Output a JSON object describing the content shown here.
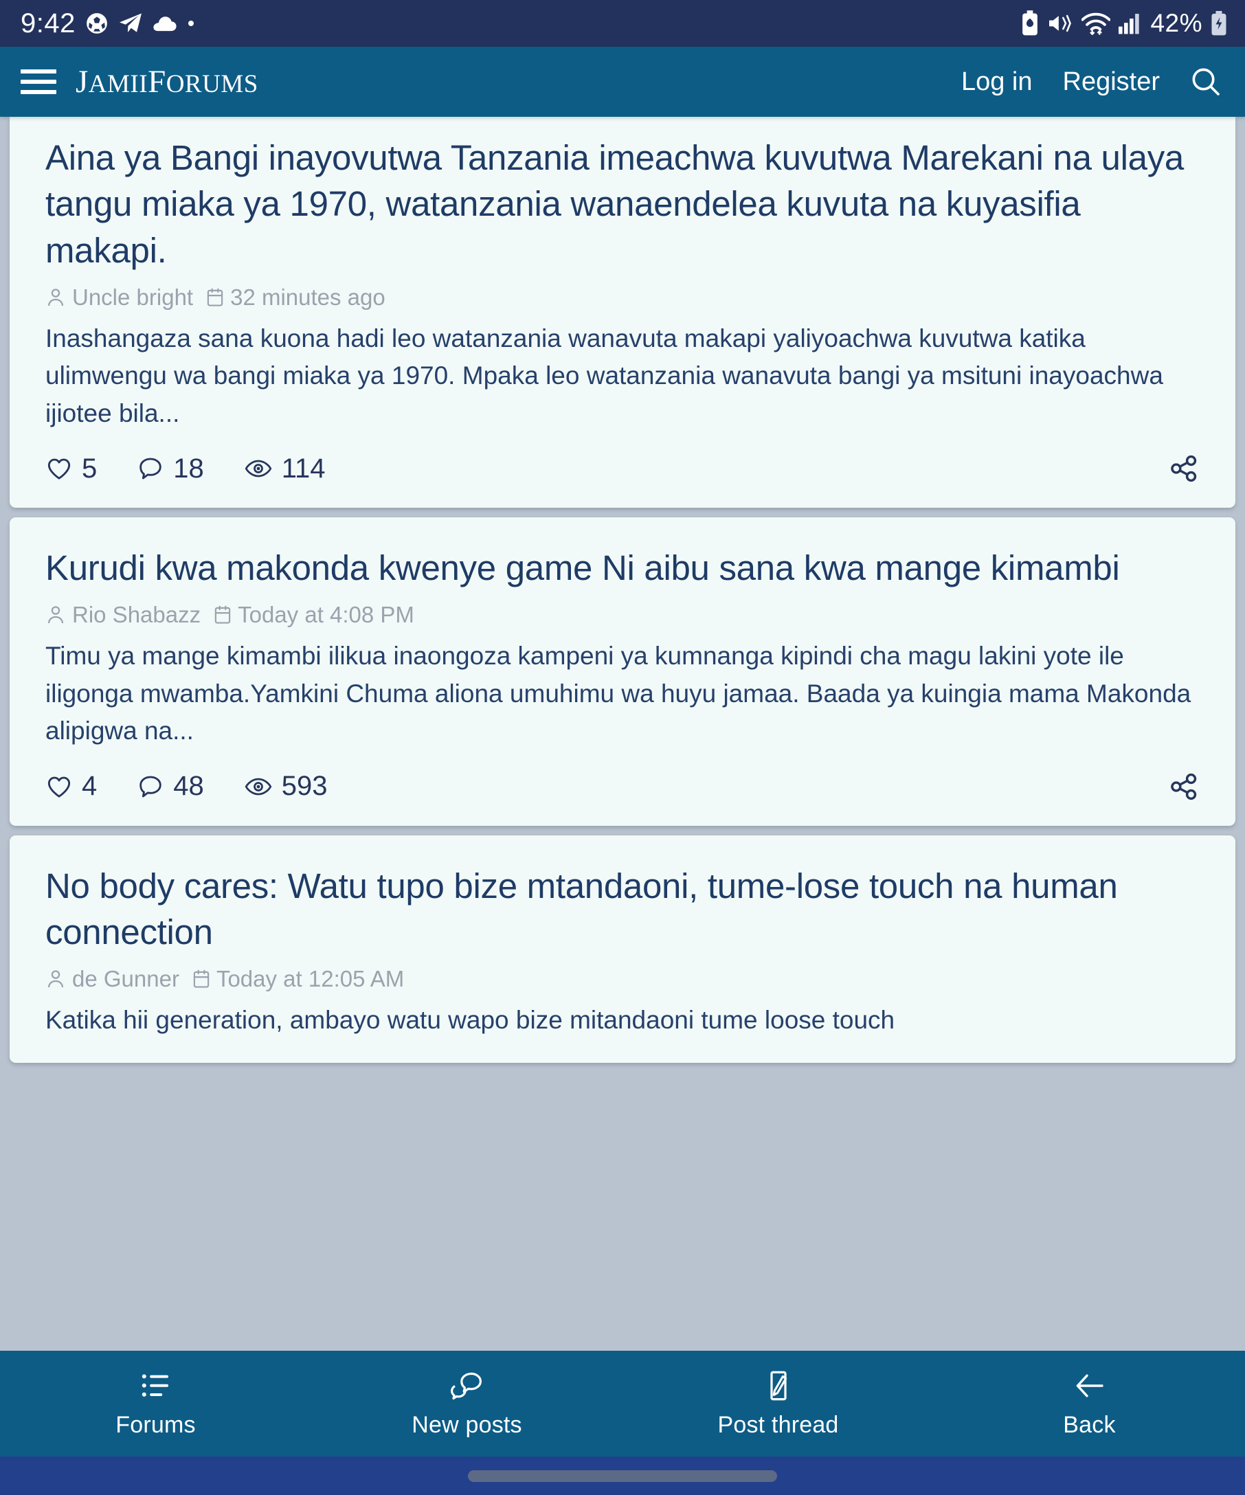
{
  "statusbar": {
    "time": "9:42",
    "battery_percent": "42%",
    "left_icons": [
      "football-icon",
      "telegram-icon",
      "cloud-icon",
      "dot-icon"
    ],
    "right_icons": [
      "battery-saver-icon",
      "mute-vibrate-icon",
      "wifi-icon",
      "cellular-signal-icon",
      "charging-battery-icon"
    ],
    "background_color": "#23325c"
  },
  "header": {
    "menu_icon": "hamburger-icon",
    "brand_full": "JamiiForums",
    "brand_part1": "J",
    "brand_part2": "AMII",
    "brand_part3": "F",
    "brand_part4": "ORUMS",
    "login_label": "Log in",
    "register_label": "Register",
    "search_icon": "search-icon",
    "background_color": "#0d5c86"
  },
  "threads": [
    {
      "title": "Aina ya Bangi inayovutwa Tanzania imeachwa kuvutwa Marekani na ulaya tangu miaka ya 1970, watanzania wanaendelea kuvuta na kuyasifia makapi.",
      "author": "Uncle bright",
      "timestamp": "32 minutes ago",
      "snippet": "Inashangaza sana kuona hadi leo watanzania wanavuta makapi yaliyoachwa kuvutwa katika ulimwengu wa bangi miaka ya 1970. Mpaka leo watanzania wanavuta bangi ya msituni inayoachwa ijiotee bila...",
      "likes": "5",
      "replies": "18",
      "views": "114",
      "share_icon": "share-icon"
    },
    {
      "title": "Kurudi kwa makonda kwenye game Ni aibu sana kwa mange kimambi",
      "author": "Rio Shabazz",
      "timestamp": "Today at 4:08 PM",
      "snippet": "Timu ya mange kimambi ilikua inaongoza kampeni ya kumnanga kipindi cha magu lakini yote ile iligonga mwamba.Yamkini Chuma aliona umuhimu wa huyu jamaa. Baada ya kuingia mama Makonda alipigwa na...",
      "likes": "4",
      "replies": "48",
      "views": "593",
      "share_icon": "share-icon"
    },
    {
      "title": "No body cares: Watu tupo bize mtandaoni, tume-lose touch na human connection",
      "author": "de Gunner",
      "timestamp": "Today at 12:05 AM",
      "snippet": "Katika hii generation, ambayo watu wapo bize mitandaoni tume loose touch",
      "likes": "",
      "replies": "",
      "views": "",
      "share_icon": "share-icon"
    }
  ],
  "bottom_nav": [
    {
      "label": "Forums",
      "icon": "list-icon"
    },
    {
      "label": "New posts",
      "icon": "comments-icon"
    },
    {
      "label": "Post thread",
      "icon": "pencil-compose-icon"
    },
    {
      "label": "Back",
      "icon": "arrow-left-icon"
    }
  ],
  "colors": {
    "status_bar": "#23325c",
    "header": "#0d5c86",
    "page_background": "#b9c3cf",
    "card_background": "#f1faf8",
    "title_text": "#1f3b66",
    "meta_text": "#9aa3ad",
    "gesture_bar": "#22408c"
  }
}
